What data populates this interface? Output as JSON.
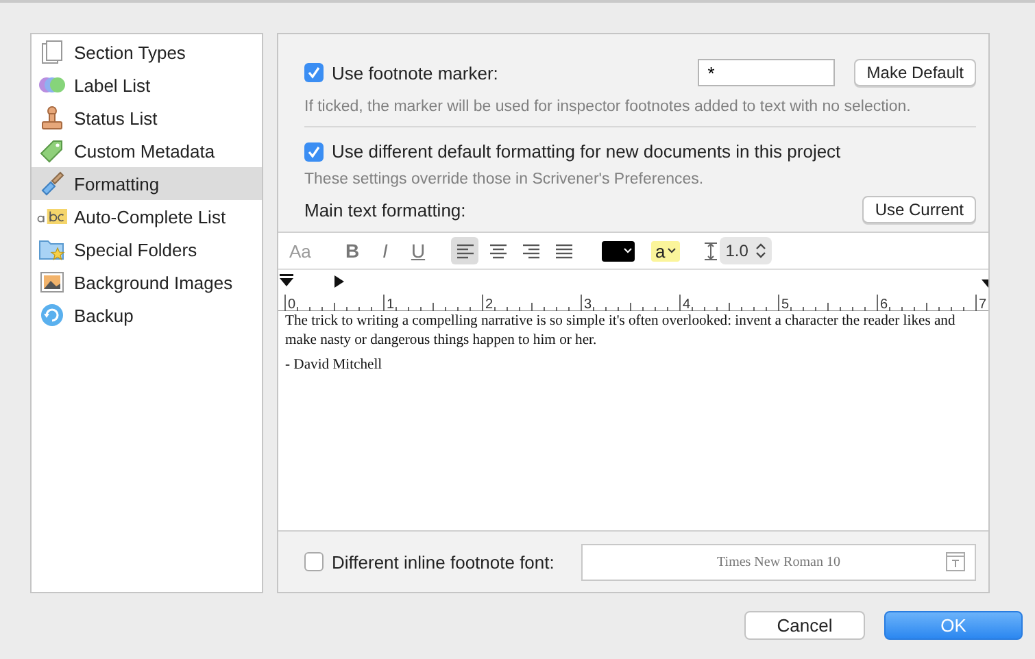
{
  "sidebar": {
    "items": [
      {
        "label": "Section Types",
        "selected": false
      },
      {
        "label": "Label List",
        "selected": false
      },
      {
        "label": "Status List",
        "selected": false
      },
      {
        "label": "Custom Metadata",
        "selected": false
      },
      {
        "label": "Formatting",
        "selected": true
      },
      {
        "label": "Auto-Complete List",
        "selected": false
      },
      {
        "label": "Special Folders",
        "selected": false
      },
      {
        "label": "Background Images",
        "selected": false
      },
      {
        "label": "Backup",
        "selected": false
      }
    ]
  },
  "footnote_marker": {
    "label": "Use footnote marker:",
    "checked": true,
    "value": "*",
    "button": "Make Default",
    "hint": "If ticked, the marker will be used for inspector footnotes added to text with no selection."
  },
  "default_formatting": {
    "label": "Use different default formatting for new documents in this project",
    "checked": true,
    "hint": "These settings override those in Scrivener's Preferences.",
    "main_label": "Main text formatting:",
    "button": "Use Current"
  },
  "toolbar": {
    "font": "Aa",
    "styles": [
      "B",
      "I",
      "U"
    ],
    "alignments": [
      {
        "selected": true
      },
      {
        "selected": false
      },
      {
        "selected": false
      },
      {
        "selected": false
      }
    ],
    "color_swatch": {
      "color": "#000000"
    },
    "highlight": {
      "label": "a",
      "color": "#fbf59b"
    },
    "line_spacing": "1.0"
  },
  "ruler": {
    "labels": [
      "0",
      "1",
      "2",
      "3",
      "4",
      "5",
      "6",
      "7"
    ]
  },
  "editor": {
    "paragraphs": [
      "The trick to writing a compelling narrative is so simple it's often overlooked: invent a character the reader likes and make nasty or dangerous things happen to him or her.",
      "- David Mitchell"
    ]
  },
  "inline_font": {
    "label": "Different inline footnote font:",
    "checked": false,
    "value": "Times New Roman 10"
  },
  "buttons": [
    {
      "label": "Cancel",
      "kind": "secondary"
    },
    {
      "label": "OK",
      "kind": "primary"
    }
  ]
}
